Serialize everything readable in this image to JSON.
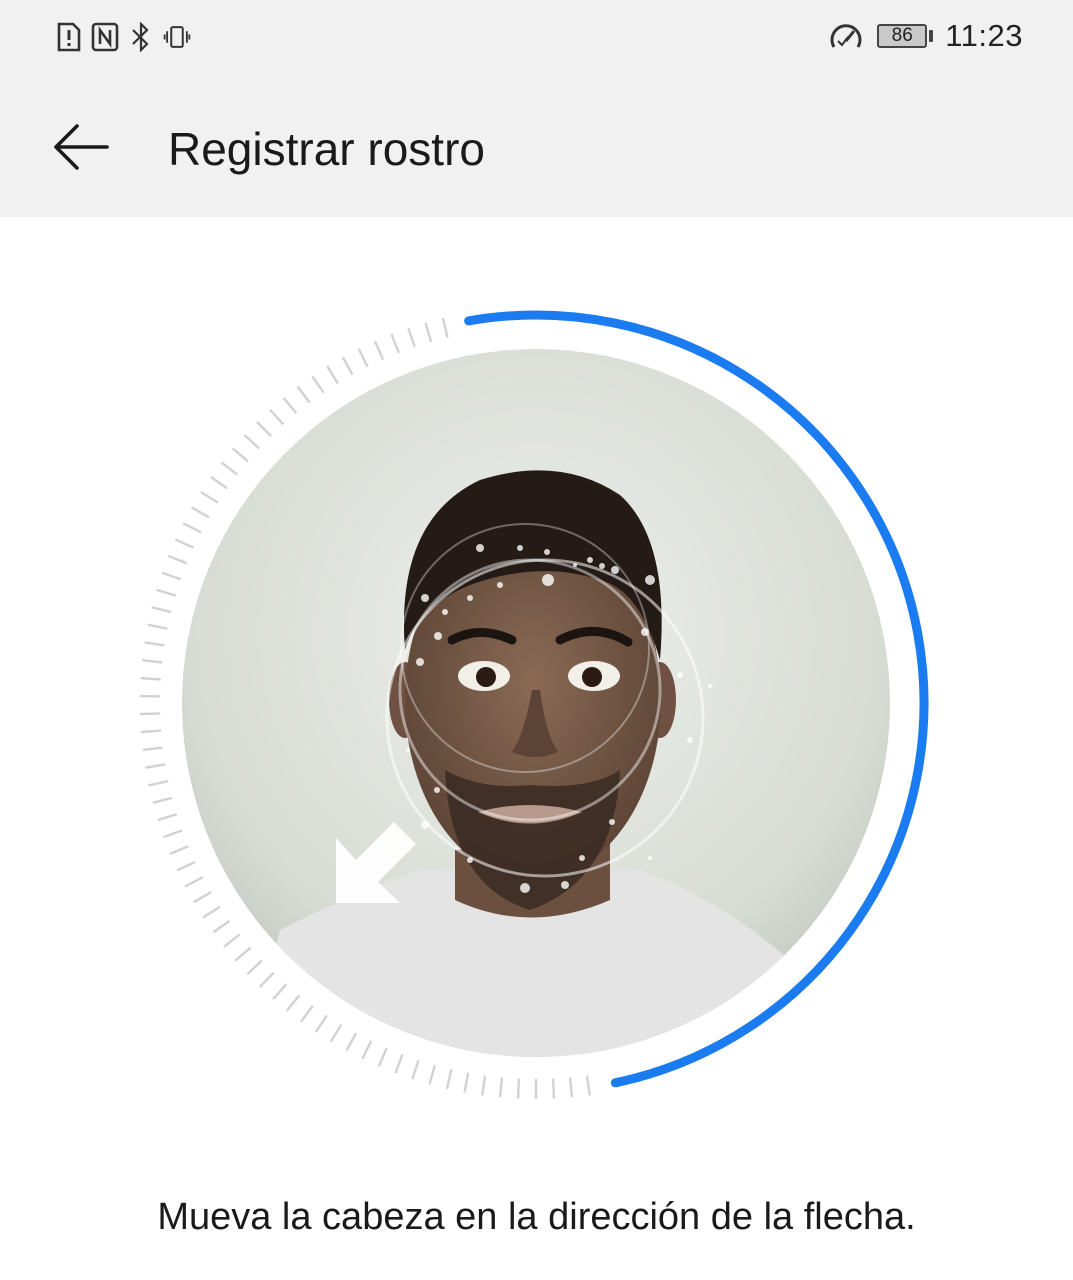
{
  "status_bar": {
    "left_icons": [
      "sim-alert-icon",
      "nfc-icon",
      "bluetooth-icon",
      "vibrate-icon"
    ],
    "speed_icon": "data-saver-icon",
    "battery": "86",
    "time": "11:23"
  },
  "app_bar": {
    "back_icon": "back-arrow-icon",
    "title": "Registrar rostro"
  },
  "scanner": {
    "progress": 0.5,
    "accent_color": "#1a7cf0",
    "direction_hint_icon": "arrow-down-left-icon"
  },
  "instruction": "Mueva la cabeza en la dirección de la flecha."
}
